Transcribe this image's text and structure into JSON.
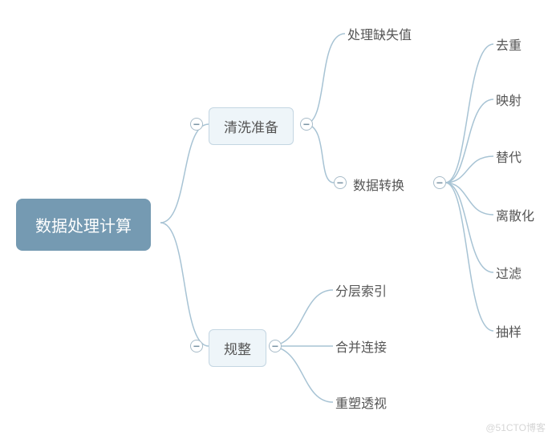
{
  "root": {
    "label": "数据处理计算"
  },
  "branches": {
    "clean": {
      "label": "清洗准备",
      "children": {
        "missing": {
          "label": "处理缺失值"
        },
        "transform": {
          "label": "数据转换",
          "children": {
            "dedup": {
              "label": "去重"
            },
            "map": {
              "label": "映射"
            },
            "replace": {
              "label": "替代"
            },
            "discrete": {
              "label": "离散化"
            },
            "filter": {
              "label": "过滤"
            },
            "sample": {
              "label": "抽样"
            }
          }
        }
      }
    },
    "tidy": {
      "label": "规整",
      "children": {
        "hier": {
          "label": "分层索引"
        },
        "merge": {
          "label": "合并连接"
        },
        "pivot": {
          "label": "重塑透视"
        }
      }
    }
  },
  "toggles": {
    "root": "−",
    "clean": "−",
    "transform": "−",
    "tidy": "−"
  },
  "watermark": "@51CTO博客"
}
